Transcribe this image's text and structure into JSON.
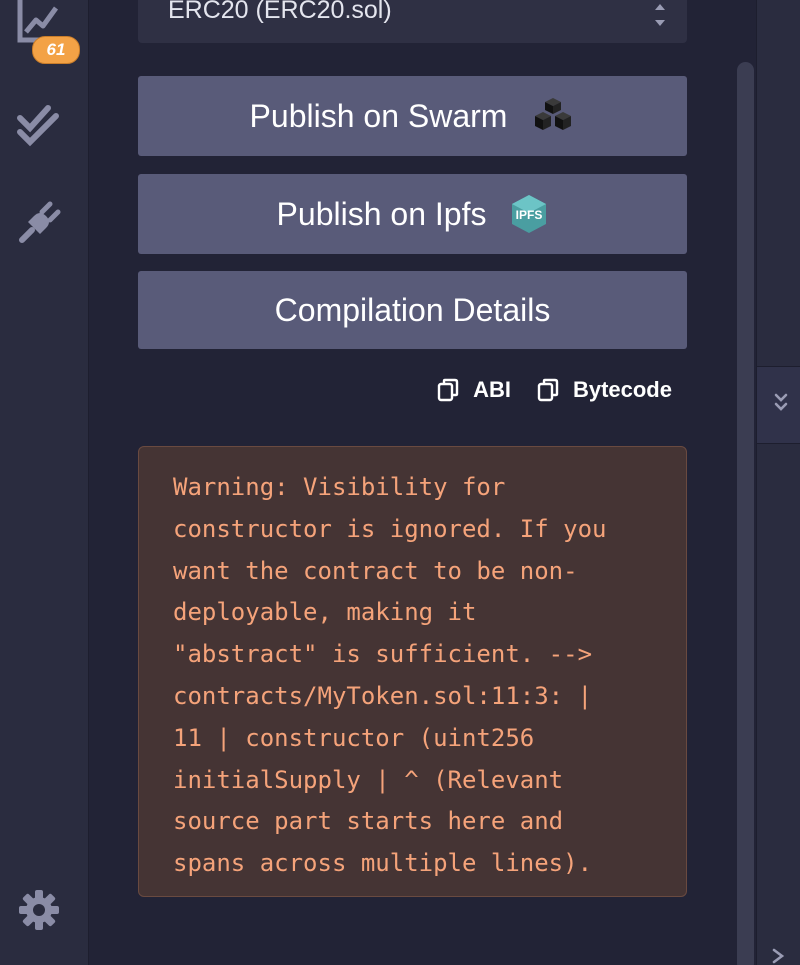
{
  "rail": {
    "analysis_badge": "61"
  },
  "compiler": {
    "selected_contract": "ERC20 (ERC20.sol)"
  },
  "buttons": {
    "publish_swarm": "Publish on Swarm",
    "publish_ipfs": "Publish on Ipfs",
    "compilation_details": "Compilation Details",
    "ipfs_logo_text": "IPFS"
  },
  "copy_actions": {
    "abi": "ABI",
    "bytecode": "Bytecode"
  },
  "warning": {
    "lines": [
      "Warning: Visibility for",
      "constructor is ignored. If you",
      "want the contract to be non-",
      "deployable, making it",
      "\"abstract\" is sufficient. -->",
      "contracts/MyToken.sol:11:3: |",
      "11 | constructor (uint256",
      "initialSupply | ^ (Relevant",
      "source part starts here and",
      "spans across multiple lines)."
    ]
  },
  "colors": {
    "background": "#222336",
    "rail": "#2a2c3f",
    "button": "#595b79",
    "badge": "#f3a246",
    "warning_bg": "#453434",
    "warning_text": "#f5a37a",
    "icon": "#8a8ca6"
  },
  "icons": {
    "analysis": "chart-line-icon",
    "tests": "double-check-icon",
    "plugins": "plug-icon",
    "settings": "gear-icon",
    "swarm": "swarm-cubes-icon",
    "ipfs": "ipfs-logo-icon",
    "copy": "copy-icon",
    "expand": "double-chevron-down-icon",
    "collapse": "chevron-right-icon"
  }
}
